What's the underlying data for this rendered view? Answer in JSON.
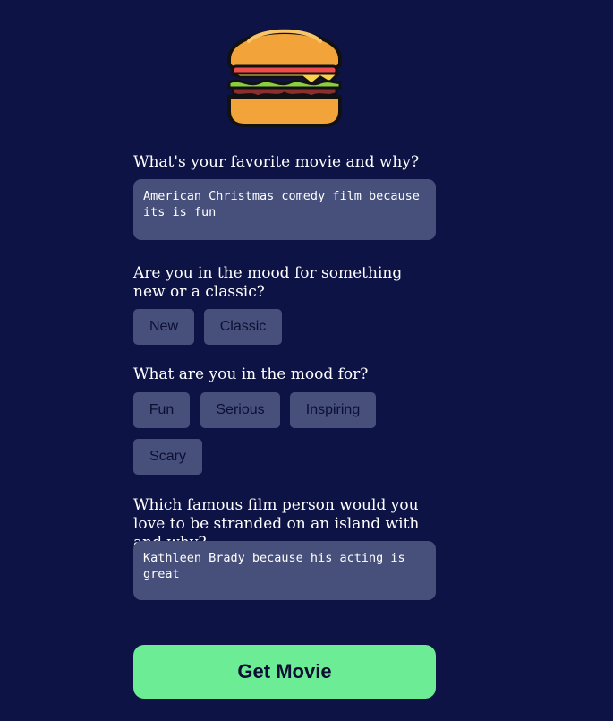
{
  "logo": {
    "icon": "burger-icon"
  },
  "questions": {
    "favorite_movie": {
      "label": "What's your favorite movie and why?",
      "value": "American Christmas comedy film because its is fun"
    },
    "new_or_classic": {
      "label": "Are you in the mood for something new or a classic?",
      "options": [
        "New",
        "Classic"
      ]
    },
    "mood": {
      "label": "What are you in the mood for?",
      "options": [
        "Fun",
        "Serious",
        "Inspiring",
        "Scary"
      ]
    },
    "stranded": {
      "label": "Which famous film person would you love to be stranded on an island with and why?",
      "value": "Kathleen Brady because his acting is great"
    }
  },
  "submit": {
    "label": "Get Movie"
  },
  "colors": {
    "background": "#0e1346",
    "field": "#47507b",
    "accent": "#6cec94"
  }
}
